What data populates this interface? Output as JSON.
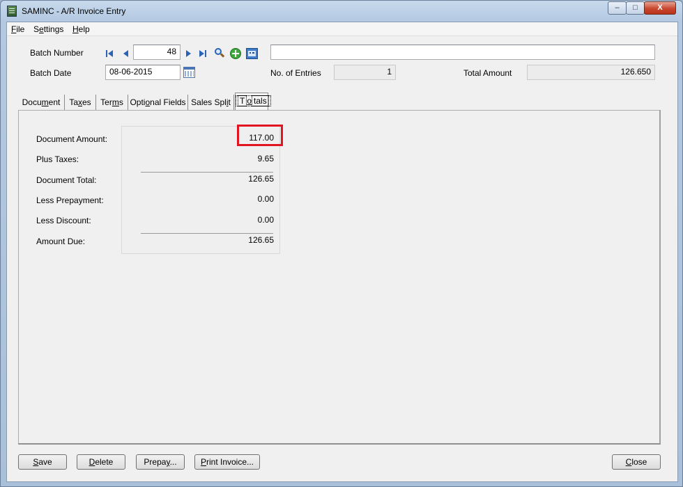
{
  "window": {
    "title": "SAMINC - A/R Invoice Entry",
    "min_glyph": "–",
    "max_glyph": "□",
    "close_glyph": "X"
  },
  "menu": {
    "file": {
      "key": "F",
      "rest": "ile"
    },
    "settings": {
      "pre": "S",
      "key": "e",
      "rest": "ttings"
    },
    "help": {
      "key": "H",
      "rest": "elp"
    }
  },
  "batch": {
    "number_label": "Batch Number",
    "number_value": "48",
    "description_value": "",
    "date_label": "Batch Date",
    "date_value": "08-06-2015",
    "entries_label": "No. of Entries",
    "entries_value": "1",
    "total_label": "Total Amount",
    "total_value": "126.650"
  },
  "icons": {
    "first": "first-record-icon",
    "previous": "previous-record-icon",
    "next": "next-record-icon",
    "last": "last-record-icon",
    "finder": "magnifier-icon",
    "new": "add-icon",
    "zoom": "zoom-detail-icon",
    "calendar": "calendar-icon"
  },
  "tabs": [
    {
      "pre": "Docu",
      "key": "m",
      "rest": "ent"
    },
    {
      "pre": "Ta",
      "key": "x",
      "rest": "es"
    },
    {
      "pre": "Ter",
      "key": "m",
      "rest": "s"
    },
    {
      "pre": "Opti",
      "key": "o",
      "rest": "nal Fields"
    },
    {
      "pre": "Sales Spl",
      "key": "i",
      "rest": "t"
    },
    {
      "pre": "T",
      "key": "o",
      "rest": "tals"
    }
  ],
  "totals": {
    "document_amount_label": "Document Amount:",
    "document_amount_value": "117.00",
    "plus_taxes_label": "Plus Taxes:",
    "plus_taxes_value": "9.65",
    "document_total_label": "Document Total:",
    "document_total_value": "126.65",
    "less_prepayment_label": "Less Prepayment:",
    "less_prepayment_value": "0.00",
    "less_discount_label": "Less Discount:",
    "less_discount_value": "0.00",
    "amount_due_label": "Amount Due:",
    "amount_due_value": "126.65"
  },
  "buttons": {
    "save": {
      "key": "S",
      "rest": "ave"
    },
    "delete": {
      "key": "D",
      "rest": "elete"
    },
    "prepay": {
      "pre": "Prepa",
      "key": "y",
      "rest": "..."
    },
    "print": {
      "key": "P",
      "rest": "rint Invoice..."
    },
    "close": {
      "key": "C",
      "rest": "lose"
    }
  },
  "colors": {
    "highlight": "#e2141f",
    "nav_blue": "#2b63b5",
    "add_green": "#3fa83a"
  }
}
